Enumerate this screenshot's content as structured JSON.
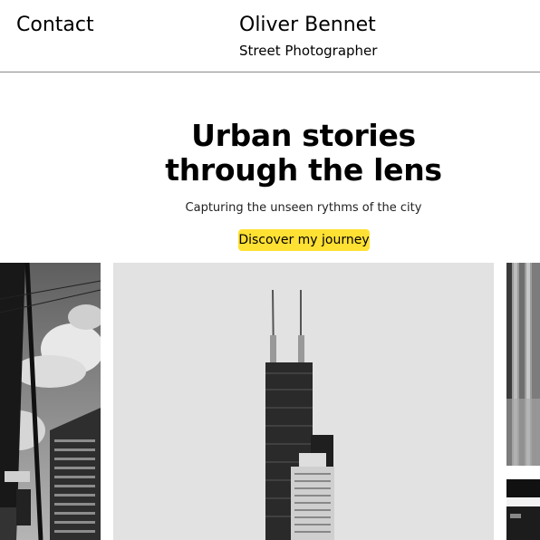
{
  "header": {
    "contact_label": "Contact",
    "name": "Oliver Bennet",
    "role": "Street Photographer"
  },
  "hero": {
    "title_line1": "Urban stories",
    "title_line2": "through the lens",
    "subtitle": "Capturing the unseen rythms of the city",
    "cta_label": "Discover my journey"
  },
  "colors": {
    "accent": "#ffe133",
    "divider": "#8a8a8a",
    "text": "#000000"
  }
}
